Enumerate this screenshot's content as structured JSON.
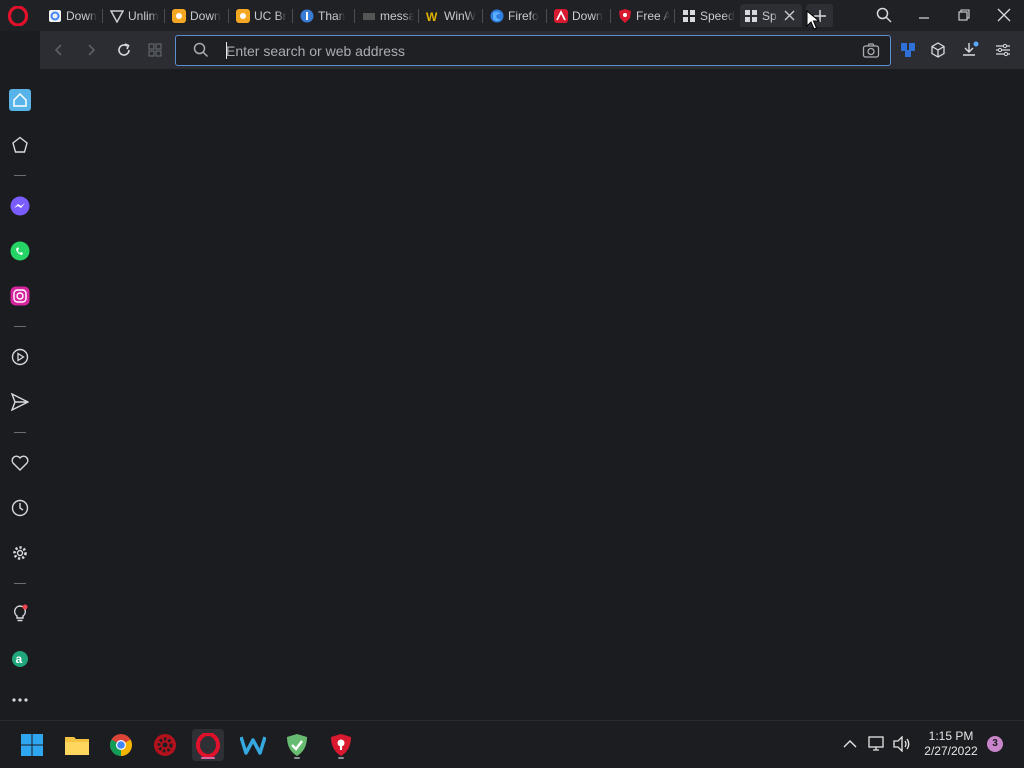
{
  "tabs": [
    {
      "title": "Down",
      "favicon": "google-drive-icon"
    },
    {
      "title": "Unlim",
      "favicon": "vpn-shield-icon"
    },
    {
      "title": "Down",
      "favicon": "uc-browser-icon"
    },
    {
      "title": "UC Br",
      "favicon": "uc-browser-icon"
    },
    {
      "title": "Than",
      "favicon": "info-circle-icon"
    },
    {
      "title": "messa",
      "favicon": "message-icon"
    },
    {
      "title": "WinW",
      "favicon": "winworld-icon"
    },
    {
      "title": "Firefo",
      "favicon": "firefox-icon"
    },
    {
      "title": "Down",
      "favicon": "avira-icon"
    },
    {
      "title": "Free A",
      "favicon": "shield-icon"
    },
    {
      "title": "Speed",
      "favicon": "speed-dial-icon"
    },
    {
      "title": "Sp",
      "favicon": "speed-dial-icon",
      "active": true
    }
  ],
  "address_bar": {
    "placeholder": "Enter search or web address"
  },
  "taskbar": {
    "apps": [
      "windows-start-icon",
      "file-explorer-icon",
      "chrome-icon",
      "settings-gear-app-icon",
      "opera-icon",
      "waterfox-icon",
      "adguard-icon",
      "security-shield-app-icon"
    ]
  },
  "clock": {
    "time": "1:15 PM",
    "date": "2/27/2022"
  },
  "notifications": {
    "count": "3"
  },
  "colors": {
    "accent": "#5a8fd0",
    "opera_red": "#e0112b",
    "background": "#1b1c20"
  }
}
